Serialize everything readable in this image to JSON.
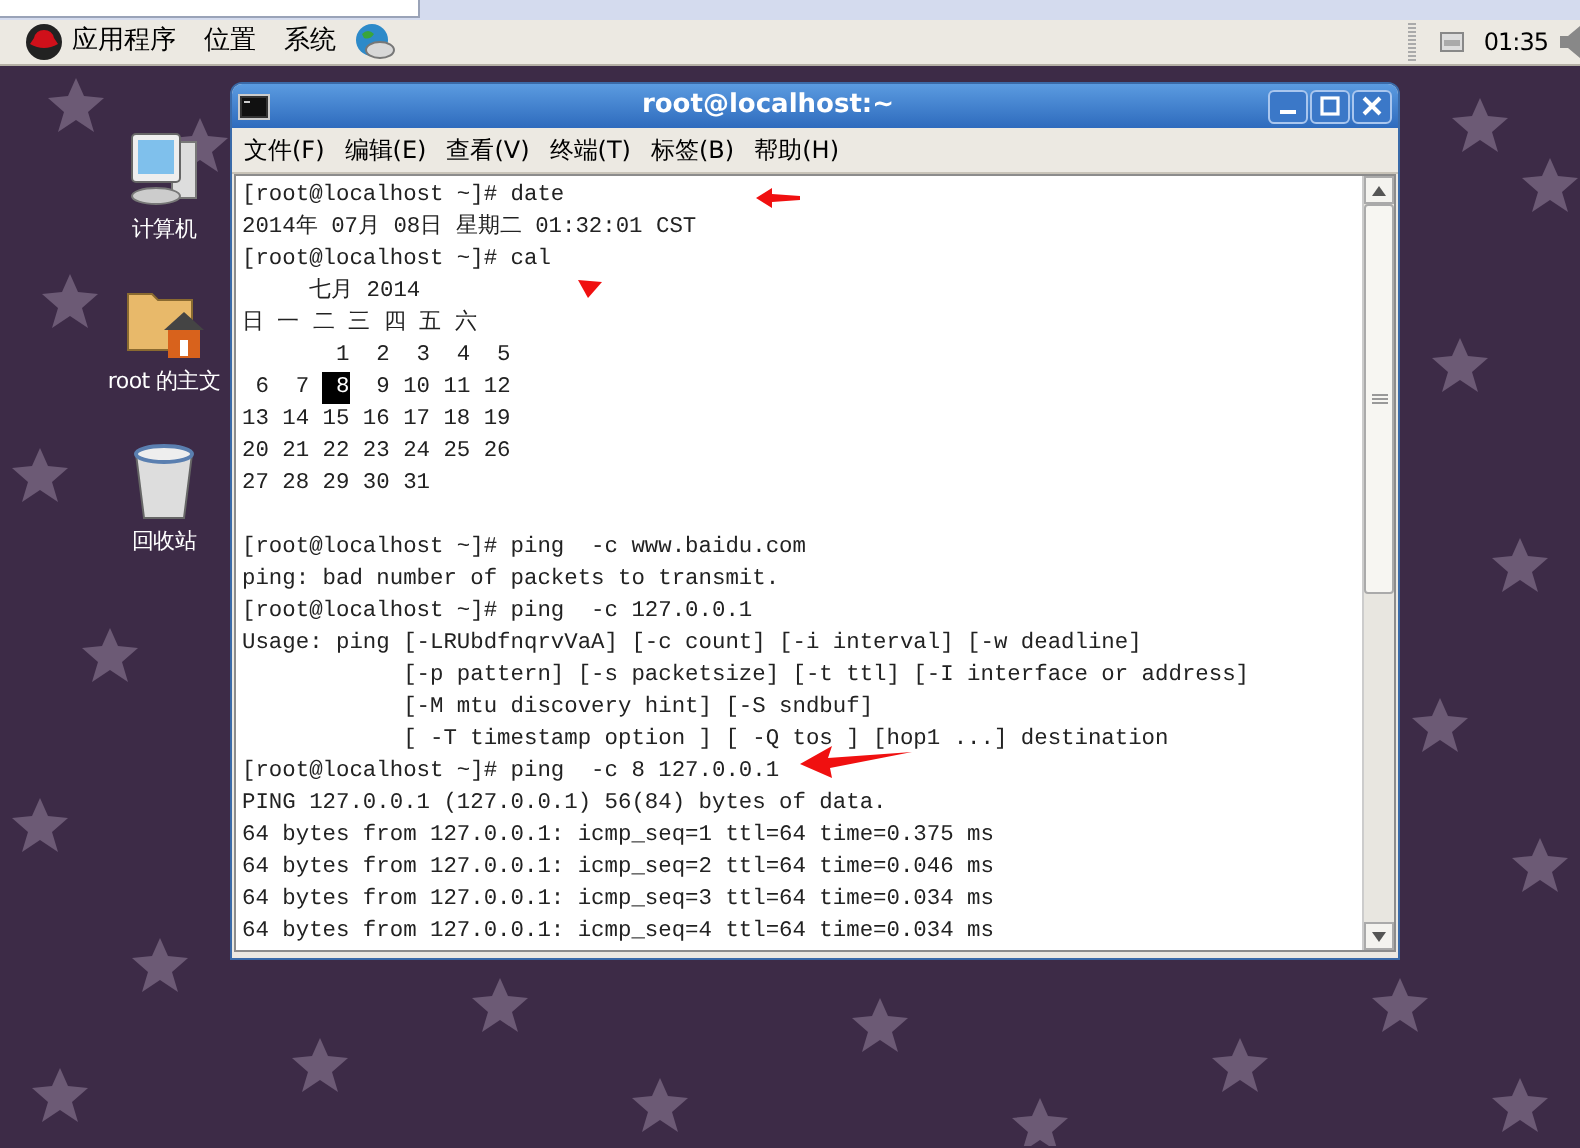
{
  "panel": {
    "menus": [
      "应用程序",
      "位置",
      "系统"
    ],
    "clock": "01:35"
  },
  "desktop_icons": [
    {
      "kind": "computer",
      "label": "计算机"
    },
    {
      "kind": "home",
      "label": "root 的主文"
    },
    {
      "kind": "trash",
      "label": "回收站"
    }
  ],
  "terminal": {
    "title": "root@localhost:~",
    "menu": [
      "文件(F)",
      "编辑(E)",
      "查看(V)",
      "终端(T)",
      "标签(B)",
      "帮助(H)"
    ],
    "lines": [
      {
        "kind": "text",
        "text": "[root@localhost ~]# date"
      },
      {
        "kind": "text",
        "text": "2014年 07月 08日 星期二 01:32:01 CST"
      },
      {
        "kind": "text",
        "text": "[root@localhost ~]# cal"
      },
      {
        "kind": "text",
        "text": "     七月 2014"
      },
      {
        "kind": "text",
        "text": "日 一 二 三 四 五 六"
      },
      {
        "kind": "text",
        "text": "       1  2  3  4  5"
      },
      {
        "kind": "calendar",
        "segments": [
          {
            "text": " 6  7 ",
            "selected": false
          },
          {
            "text": " 8",
            "selected": true
          },
          {
            "text": "  9 10 11 12",
            "selected": false
          }
        ]
      },
      {
        "kind": "text",
        "text": "13 14 15 16 17 18 19"
      },
      {
        "kind": "text",
        "text": "20 21 22 23 24 25 26"
      },
      {
        "kind": "text",
        "text": "27 28 29 30 31"
      },
      {
        "kind": "blank"
      },
      {
        "kind": "text",
        "text": "[root@localhost ~]# ping  -c www.baidu.com"
      },
      {
        "kind": "text",
        "text": "ping: bad number of packets to transmit."
      },
      {
        "kind": "text",
        "text": "[root@localhost ~]# ping  -c 127.0.0.1"
      },
      {
        "kind": "text",
        "text": "Usage: ping [-LRUbdfnqrvVaA] [-c count] [-i interval] [-w deadline]"
      },
      {
        "kind": "text",
        "text": "            [-p pattern] [-s packetsize] [-t ttl] [-I interface or address]"
      },
      {
        "kind": "text",
        "text": "            [-M mtu discovery hint] [-S sndbuf]"
      },
      {
        "kind": "text",
        "text": "            [ -T timestamp option ] [ -Q tos ] [hop1 ...] destination"
      },
      {
        "kind": "text",
        "text": "[root@localhost ~]# ping  -c 8 127.0.0.1"
      },
      {
        "kind": "text",
        "text": "PING 127.0.0.1 (127.0.0.1) 56(84) bytes of data."
      },
      {
        "kind": "text",
        "text": "64 bytes from 127.0.0.1: icmp_seq=1 ttl=64 time=0.375 ms"
      },
      {
        "kind": "text",
        "text": "64 bytes from 127.0.0.1: icmp_seq=2 ttl=64 time=0.046 ms"
      },
      {
        "kind": "text",
        "text": "64 bytes from 127.0.0.1: icmp_seq=3 ttl=64 time=0.034 ms"
      },
      {
        "kind": "text",
        "text": "64 bytes from 127.0.0.1: icmp_seq=4 ttl=64 time=0.034 ms"
      }
    ]
  }
}
